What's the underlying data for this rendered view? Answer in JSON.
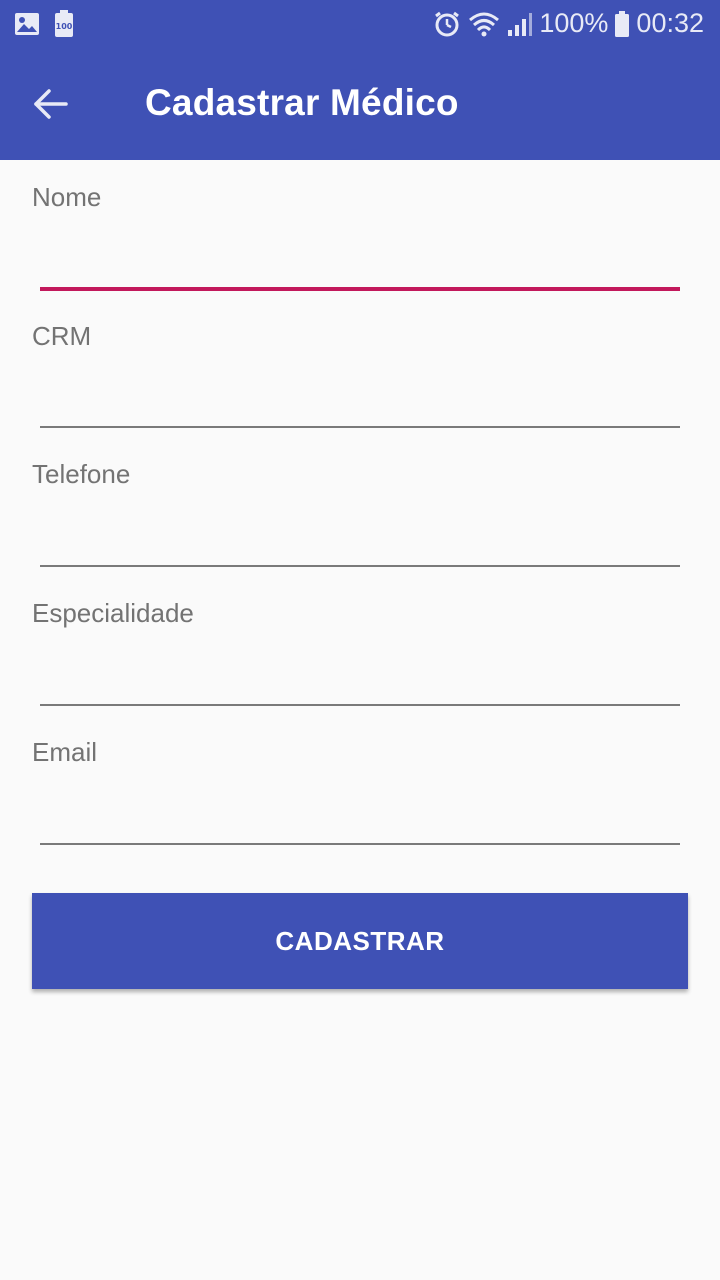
{
  "status_bar": {
    "battery_percent": "100%",
    "time": "00:32",
    "left_icons": [
      "gallery-icon",
      "battery-100-icon"
    ],
    "right_icons": [
      "alarm-icon",
      "wifi-icon",
      "signal-icon",
      "battery-icon"
    ]
  },
  "toolbar": {
    "title": "Cadastrar Médico",
    "back_icon": "arrow-back-icon",
    "background": "#3f51b5"
  },
  "form": {
    "fields": [
      {
        "label": "Nome",
        "value": "",
        "focused": true
      },
      {
        "label": "CRM",
        "value": "",
        "focused": false
      },
      {
        "label": "Telefone",
        "value": "",
        "focused": false
      },
      {
        "label": "Especialidade",
        "value": "",
        "focused": false
      },
      {
        "label": "Email",
        "value": "",
        "focused": false
      }
    ],
    "submit_label": "CADASTRAR",
    "accent_color": "#c2185b"
  }
}
